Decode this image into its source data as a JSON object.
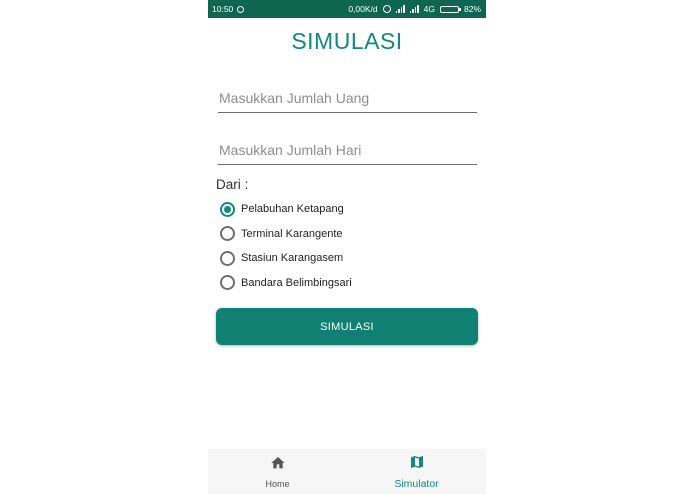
{
  "status_bar": {
    "time": "10:50",
    "speed": "0,00K/d",
    "network": "4G",
    "battery": "82%",
    "battery_level": 0.82
  },
  "page": {
    "title": "SIMULASI"
  },
  "form": {
    "amount_placeholder": "Masukkan Jumlah Uang",
    "amount_value": "",
    "days_placeholder": "Masukkan Jumlah Hari",
    "days_value": "",
    "from_label": "Dari :",
    "options": [
      {
        "label": "Pelabuhan Ketapang",
        "checked": true
      },
      {
        "label": "Terminal Karangente",
        "checked": false
      },
      {
        "label": "Stasiun Karangasem",
        "checked": false
      },
      {
        "label": "Bandara Belimbingsari",
        "checked": false
      }
    ],
    "submit_label": "SIMULASI"
  },
  "colors": {
    "accent": "#12897a",
    "status_bar": "#0f6650",
    "button": "#0f8072"
  },
  "bottom_nav": {
    "items": [
      {
        "label": "Home",
        "icon": "home-icon",
        "active": false
      },
      {
        "label": "Simulator",
        "icon": "map-icon",
        "active": true
      }
    ]
  }
}
